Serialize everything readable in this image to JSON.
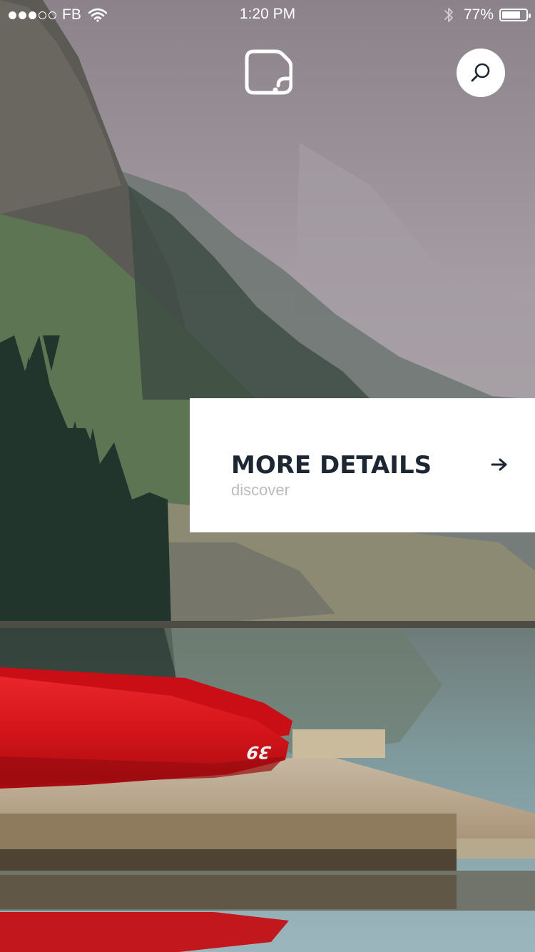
{
  "status_bar": {
    "carrier": "FB",
    "time": "1:20 PM",
    "battery_percent_label": "77%",
    "battery_level": 0.77,
    "signal_bars_filled": 3,
    "signal_bars_total": 5
  },
  "header": {
    "logo_icon": "sticky-note-icon",
    "search_icon": "search-icon"
  },
  "card": {
    "title": "MORE DETAILS",
    "subtitle": "discover",
    "arrow_icon": "arrow-right-icon"
  },
  "kayak": {
    "number": "39"
  },
  "colors": {
    "card_background": "#ffffff",
    "title_color": "#1d2734",
    "subtitle_color": "#bcbcbc",
    "kayak_red": "#d5131a",
    "icon_white": "#ffffff"
  }
}
